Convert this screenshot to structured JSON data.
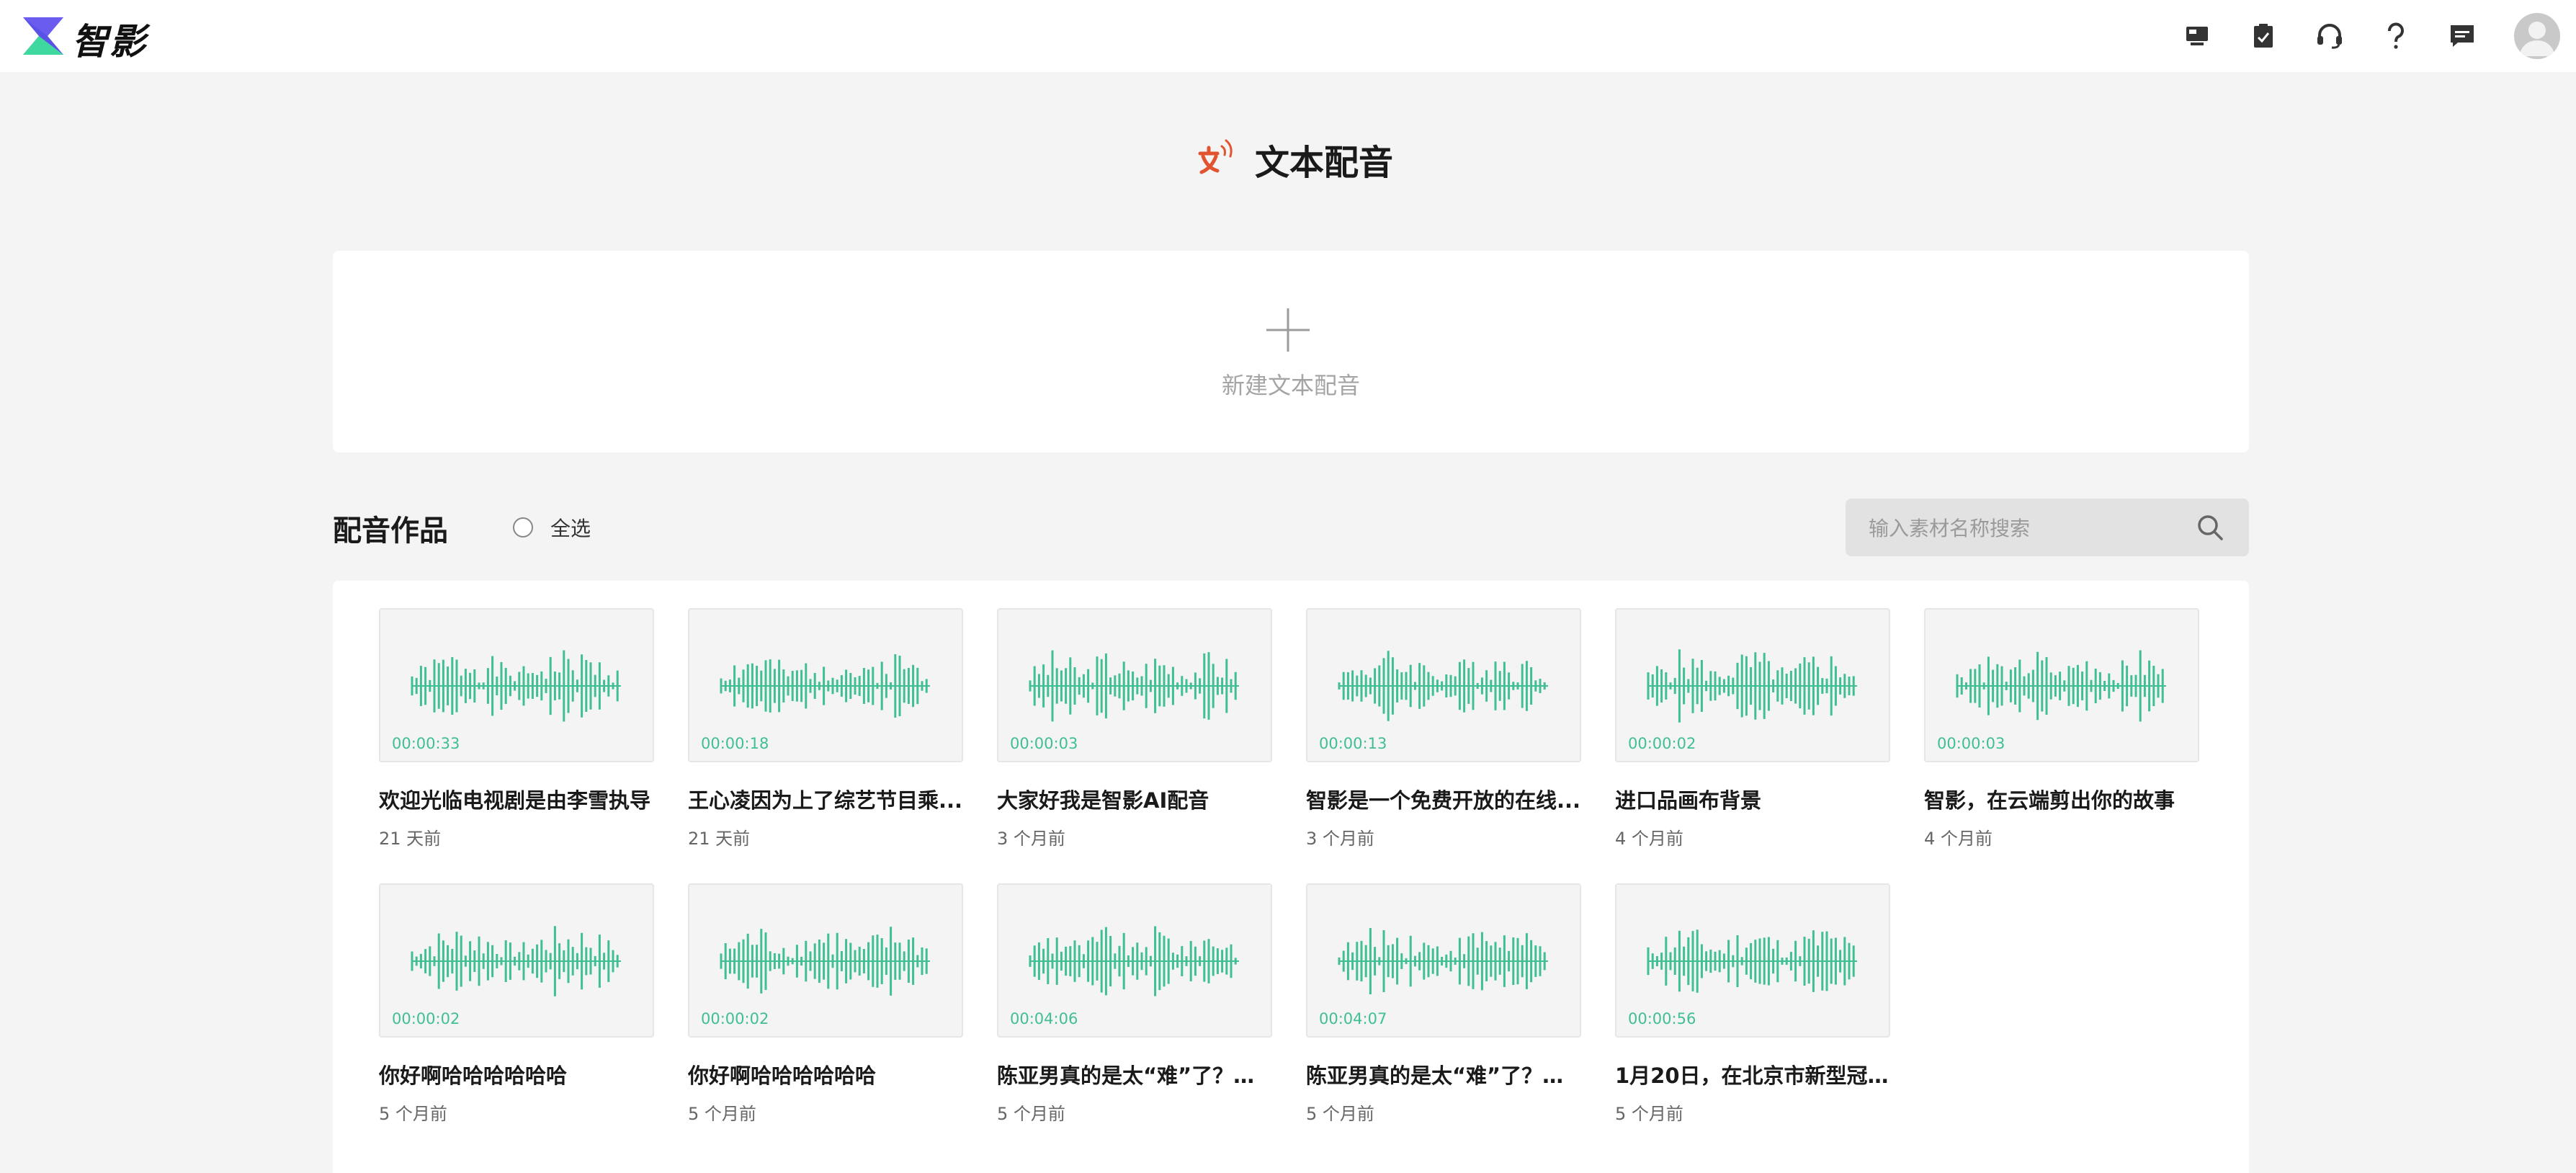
{
  "app": {
    "brand": "智影"
  },
  "header_icons": [
    "monitor-icon",
    "clipboard-check-icon",
    "headset-icon",
    "help-icon",
    "message-icon"
  ],
  "page": {
    "title": "文本配音"
  },
  "new_card": {
    "label": "新建文本配音"
  },
  "section": {
    "title": "配音作品",
    "select_all": "全选"
  },
  "search": {
    "placeholder": "输入素材名称搜索"
  },
  "colors": {
    "accent": "#3fbf92",
    "title_icon": "#e0552f"
  },
  "items": [
    {
      "name": "欢迎光临电视剧是由李雪执导",
      "time": "21 天前",
      "duration": "00:00:33"
    },
    {
      "name": "王心凌因为上了综艺节目乘...",
      "time": "21 天前",
      "duration": "00:00:18"
    },
    {
      "name": "大家好我是智影AI配音",
      "time": "3 个月前",
      "duration": "00:00:03"
    },
    {
      "name": "智影是一个免费开放的在线...",
      "time": "3 个月前",
      "duration": "00:00:13"
    },
    {
      "name": "进口品画布背景",
      "time": "4 个月前",
      "duration": "00:00:02"
    },
    {
      "name": "智影，在云端剪出你的故事",
      "time": "4 个月前",
      "duration": "00:00:03"
    },
    {
      "name": "你好啊哈哈哈哈哈哈",
      "time": "5 个月前",
      "duration": "00:00:02"
    },
    {
      "name": "你好啊哈哈哈哈哈哈",
      "time": "5 个月前",
      "duration": "00:00:02"
    },
    {
      "name": "陈亚男真的是太“难”了？从宣",
      "time": "5 个月前",
      "duration": "00:04:06"
    },
    {
      "name": "陈亚男真的是太“难”了？从宣",
      "time": "5 个月前",
      "duration": "00:04:07"
    },
    {
      "name": "1月20日，在北京市新型冠...",
      "time": "5 个月前",
      "duration": "00:00:56"
    }
  ]
}
